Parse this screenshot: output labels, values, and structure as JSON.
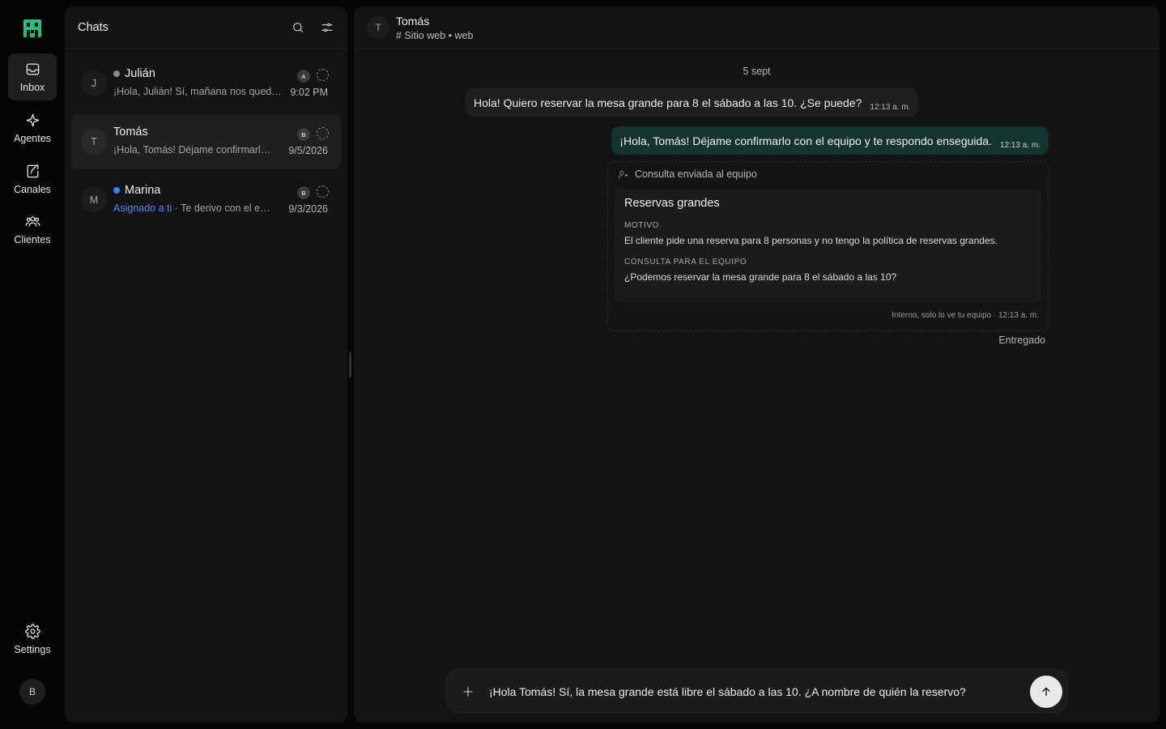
{
  "rail": {
    "items": [
      {
        "label": "Inbox",
        "icon": "inbox-icon"
      },
      {
        "label": "Agentes",
        "icon": "sparkle-icon"
      },
      {
        "label": "Canales",
        "icon": "channels-icon"
      },
      {
        "label": "Clientes",
        "icon": "users-icon"
      }
    ],
    "settings": {
      "label": "Settings",
      "icon": "gear-icon"
    },
    "user_initial": "B",
    "brand_color": "#1fc27c"
  },
  "chats": {
    "title": "Chats",
    "list": [
      {
        "initial": "J",
        "name": "Julián",
        "status_dot_color": "#8a8a8a",
        "assigned": "",
        "preview": "¡Hola, Julián! Sí, mañana nos queda...",
        "badge": "A",
        "time": "9:02 PM"
      },
      {
        "initial": "T",
        "name": "Tomás",
        "status_dot_color": "",
        "assigned": "",
        "preview": "¡Hola, Tomás! Déjame confirmarlo con el equipo y te respondo enseguida.",
        "badge": "B",
        "time": "9/5/2026"
      },
      {
        "initial": "M",
        "name": "Marina",
        "status_dot_color": "#3b82f6",
        "assigned": "Asignado a ti",
        "preview": " · Te derivo con el equipo",
        "badge": "B",
        "time": "9/3/2026"
      }
    ]
  },
  "conversation": {
    "initial": "T",
    "name": "Tomás",
    "subtitle": "# Sitio web • web",
    "date": "5 sept",
    "incoming": {
      "text": "Hola! Quiero reservar la mesa grande para 8 el sábado a las 10. ¿Se puede?",
      "time": "12:13 a. m."
    },
    "outgoing": {
      "text": "¡Hola, Tomás! Déjame confirmarlo con el equipo y te respondo enseguida.",
      "time": "12:13 a. m."
    },
    "internal": {
      "header": "Consulta enviada al equipo",
      "title": "Reservas grandes",
      "motivo_label": "MOTIVO",
      "motivo": "El cliente pide una reserva para 8 personas y no tengo la política de reservas grandes.",
      "consulta_label": "CONSULTA PARA EL EQUIPO",
      "consulta": "¿Podemos reservar la mesa grande para 8 el sábado a las 10?",
      "footer": "Interno, solo lo ve tu equipo · 12:13 a. m."
    },
    "delivered": "Entregado",
    "composer": {
      "value": "¡Hola Tomás! Sí, la mesa grande está libre el sábado a las 10. ¿A nombre de quién la reservo?"
    }
  }
}
